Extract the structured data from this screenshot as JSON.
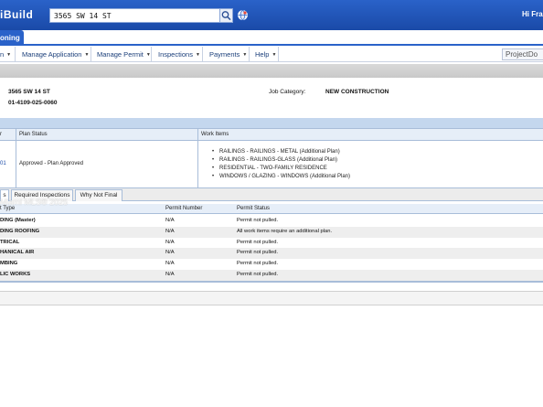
{
  "header": {
    "brand": "iBuild",
    "search_value": "3565 SW 14 ST",
    "greeting": "Hi Fran"
  },
  "tabs": {
    "active": "oning"
  },
  "menu": {
    "items": [
      {
        "label": "n"
      },
      {
        "label": "Manage Application"
      },
      {
        "label": "Manage Permit"
      },
      {
        "label": "Inspections"
      },
      {
        "label": "Payments"
      },
      {
        "label": "Help"
      }
    ],
    "projectdox": "ProjectDo"
  },
  "info": {
    "address": "3565 SW 14 ST",
    "folio": "01-4109-025-0060",
    "job_category_label": "Job Category:",
    "job_category_value": "NEW CONSTRUCTION"
  },
  "plan_table": {
    "headers": [
      "r",
      "Plan Status",
      "Work Items"
    ],
    "row": {
      "id": "01",
      "status": "Approved - Plan Approved",
      "work_items": [
        "RAILINGS - RAILINGS - METAL  (Additional Plan)",
        "RAILINGS - RAILINGS-GLASS  (Additional Plan)",
        "RESIDENTIAL - TWO-FAMILY RESIDENCE",
        "WINDOWS / GLAZING - WINDOWS  (Additional Plan)"
      ]
    }
  },
  "subtabs": [
    "s",
    "Required Inspections",
    "Why Not Final"
  ],
  "permit_table": {
    "headers": [
      "t Type",
      "Permit Number",
      "Permit Status"
    ],
    "rows": [
      {
        "type": "DING (Master)",
        "number": "N/A",
        "status": "Permit not pulled."
      },
      {
        "type": "DING ROOFING",
        "number": "N/A",
        "status": "All work items require an additional plan."
      },
      {
        "type": "TRICAL",
        "number": "N/A",
        "status": "Permit not pulled."
      },
      {
        "type": "HANICAL AIR",
        "number": "N/A",
        "status": "Permit not pulled."
      },
      {
        "type": "MBING",
        "number": "N/A",
        "status": "Permit not pulled."
      },
      {
        "type": "LIC WORKS",
        "number": "N/A",
        "status": "Permit not pulled."
      }
    ]
  },
  "watermark": "Miami MLS® 2025",
  "colors": {
    "header_blue": "#1a4aa8",
    "header_light": "#c4d7ee",
    "link_blue": "#1b3f7a"
  }
}
